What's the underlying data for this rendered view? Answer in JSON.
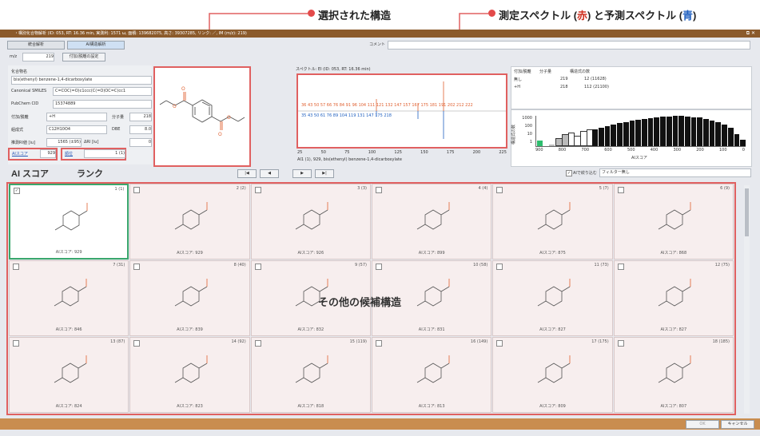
{
  "annotations": {
    "selected_structure": "選択された構造",
    "spectra_pre": "測定スペクトル (",
    "spectra_red": "赤",
    "spectra_mid": ") と予測スペクトル (",
    "spectra_blue": "青",
    "spectra_post": ")",
    "ai_score": "AI スコア",
    "rank": "ランク",
    "other_candidates": "その他の候補構造"
  },
  "window": {
    "title": "・構別化合物解析 (ID: 053, RT: 16.36 min, 実測利: 1571 ω, 面積: 139682075, 高さ: 39307285, リンク: ／, IM (m/z): 219)"
  },
  "tabs": [
    "統合解析",
    "AI構造解析"
  ],
  "comment_label": "コメント",
  "mz": {
    "label": "m/z",
    "value": "219",
    "button": "付加/脱離の設定"
  },
  "compound": {
    "name_label": "化合物名",
    "name_value": "bis(ethenyl) benzene-1,4-dicarboxylate",
    "smiles_label": "Canonical SMILES",
    "smiles_value": "C=COC(=O)c1ccc(C(=O)OC=C)cc1",
    "cid_label": "PubChem CID",
    "cid_value": "15374889",
    "adduct_label": "付加/脱離",
    "adduct_value": "+H",
    "mw_label": "分子量",
    "mw_value": "218",
    "formula_label": "組成式",
    "formula_value": "C12H10O4",
    "dbe_label": "DBE",
    "dbe_value": "8.0",
    "ri_label": "推測RI値 [iu]",
    "ri_value": "1565 (±95)",
    "dri_label": "ΔRI [iu]",
    "dri_value": "0",
    "ai_score_label": "AIスコア",
    "ai_score_value": "929",
    "rank_label": "順位",
    "rank_value": "1 (1)"
  },
  "spectrum": {
    "header": "スペクトル: EI (ID: 053, RT: 16.36 min)",
    "footer": "AI1 (1), 929, bis(ethenyl) benzene-1,4-dicarboxylate",
    "xticks": [
      "25",
      "50",
      "75",
      "100",
      "125",
      "150",
      "175",
      "200",
      "225"
    ],
    "red_labels": [
      "36",
      "43",
      "50",
      "57",
      "66",
      "76",
      "84",
      "91",
      "96",
      "104",
      "111",
      "121",
      "132",
      "147",
      "157",
      "167",
      "175",
      "181",
      "191",
      "202",
      "212",
      "222"
    ],
    "blue_labels": [
      "35",
      "43",
      "50",
      "61",
      "76",
      "89",
      "104",
      "119",
      "131",
      "147",
      "175",
      "218"
    ]
  },
  "adduct_table": {
    "headers": [
      "付加/脱離",
      "分子量",
      "構造式の数"
    ],
    "rows": [
      [
        "無し",
        "219",
        "12 (11628)"
      ],
      [
        "+H",
        "218",
        "112 (21100)"
      ]
    ]
  },
  "histogram": {
    "ylabel": "構造式の数",
    "xlabel": "AIスコア",
    "yticks": [
      "1000",
      "100",
      "10",
      "1"
    ],
    "xticks": [
      "900",
      "800",
      "700",
      "600",
      "500",
      "400",
      "300",
      "200",
      "100",
      "0"
    ],
    "heights": [
      0.18,
      0,
      0.05,
      0.22,
      0.35,
      0.4,
      0.3,
      0.45,
      0.5,
      0.55,
      0.6,
      0.66,
      0.72,
      0.76,
      0.8,
      0.84,
      0.88,
      0.9,
      0.93,
      0.95,
      0.97,
      0.98,
      0.99,
      1,
      0.98,
      0.96,
      0.94,
      0.9,
      0.85,
      0.8,
      0.72,
      0.6,
      0.4,
      0.2
    ]
  },
  "nav": {
    "first": "|◀",
    "prev": "◀",
    "next": "▶",
    "last": "▶|",
    "filter_check": "AIで絞り込む",
    "filter_select": "フィルター無し"
  },
  "cards": [
    {
      "rank": "1 (1)",
      "score": "AIスコア: 929",
      "checked": "✓"
    },
    {
      "rank": "2 (2)",
      "score": "AIスコア: 929",
      "checked": ""
    },
    {
      "rank": "3 (3)",
      "score": "AIスコア: 926",
      "checked": ""
    },
    {
      "rank": "4 (4)",
      "score": "AIスコア: 899",
      "checked": ""
    },
    {
      "rank": "5 (7)",
      "score": "AIスコア: 875",
      "checked": ""
    },
    {
      "rank": "6 (9)",
      "score": "AIスコア: 868",
      "checked": ""
    },
    {
      "rank": "7 (31)",
      "score": "AIスコア: 846",
      "checked": ""
    },
    {
      "rank": "8 (40)",
      "score": "AIスコア: 839",
      "checked": ""
    },
    {
      "rank": "9 (57)",
      "score": "AIスコア: 832",
      "checked": ""
    },
    {
      "rank": "10 (58)",
      "score": "AIスコア: 831",
      "checked": ""
    },
    {
      "rank": "11 (73)",
      "score": "AIスコア: 827",
      "checked": ""
    },
    {
      "rank": "12 (75)",
      "score": "AIスコア: 827",
      "checked": ""
    },
    {
      "rank": "13 (87)",
      "score": "AIスコア: 824",
      "checked": ""
    },
    {
      "rank": "14 (92)",
      "score": "AIスコア: 823",
      "checked": ""
    },
    {
      "rank": "15 (119)",
      "score": "AIスコア: 818",
      "checked": ""
    },
    {
      "rank": "16 (149)",
      "score": "AIスコア: 813",
      "checked": ""
    },
    {
      "rank": "17 (175)",
      "score": "AIスコア: 809",
      "checked": ""
    },
    {
      "rank": "18 (185)",
      "score": "AIスコア: 807",
      "checked": ""
    }
  ],
  "footer": {
    "ok": "OK",
    "cancel": "キャンセル"
  }
}
